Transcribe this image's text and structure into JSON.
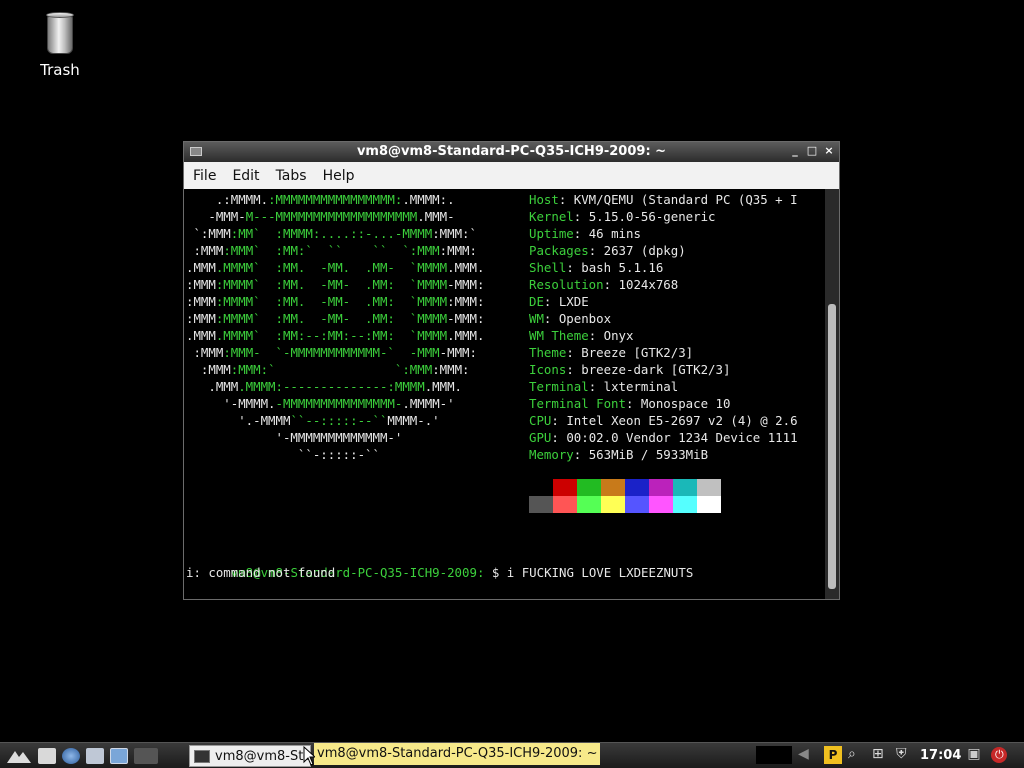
{
  "desktop": {
    "trash_label": "Trash"
  },
  "window": {
    "title": "vm8@vm8-Standard-PC-Q35-ICH9-2009: ~",
    "controls": [
      "_",
      "□",
      "×"
    ],
    "menu": [
      "File",
      "Edit",
      "Tabs",
      "Help"
    ]
  },
  "logo_lines": [
    [
      {
        "t": "    .:MMMM.",
        "c": "w"
      },
      {
        "t": ":MMMMMMMMMMMMMMMM:",
        "c": "g"
      },
      {
        "t": ".MMMM:.",
        "c": "w"
      }
    ],
    [
      {
        "t": "   -MMM-",
        "c": "w"
      },
      {
        "t": "M---MMMMMMMMMMMMMMMMMMM",
        "c": "g"
      },
      {
        "t": ".MMM-",
        "c": "w"
      }
    ],
    [
      {
        "t": " `:MMM",
        "c": "w"
      },
      {
        "t": ":MM`  :MMMM:....::-...-MMMM",
        "c": "g"
      },
      {
        "t": ":MMM:`",
        "c": "w"
      }
    ],
    [
      {
        "t": " :MMM",
        "c": "w"
      },
      {
        "t": ":MMM`  :MM:`  ``    ``  `:MMM",
        "c": "g"
      },
      {
        "t": ":MMM:",
        "c": "w"
      }
    ],
    [
      {
        "t": ".MMM",
        "c": "w"
      },
      {
        "t": ".MMMM`  :MM.  -MM.  .MM-  `MMMM",
        "c": "g"
      },
      {
        "t": ".MMM.",
        "c": "w"
      }
    ],
    [
      {
        "t": ":MMM",
        "c": "w"
      },
      {
        "t": ":MMMM`  :MM.  -MM-  .MM:  `MMMM",
        "c": "g"
      },
      {
        "t": "-MMM:",
        "c": "w"
      }
    ],
    [
      {
        "t": ":MMM",
        "c": "w"
      },
      {
        "t": ":MMMM`  :MM.  -MM-  .MM:  `MMMM",
        "c": "g"
      },
      {
        "t": ":MMM:",
        "c": "w"
      }
    ],
    [
      {
        "t": ":MMM",
        "c": "w"
      },
      {
        "t": ":MMMM`  :MM.  -MM-  .MM:  `MMMM",
        "c": "g"
      },
      {
        "t": "-MMM:",
        "c": "w"
      }
    ],
    [
      {
        "t": ".MMM",
        "c": "w"
      },
      {
        "t": ".MMMM`  :MM:--:MM:--:MM:  `MMMM",
        "c": "g"
      },
      {
        "t": ".MMM.",
        "c": "w"
      }
    ],
    [
      {
        "t": " :MMM",
        "c": "w"
      },
      {
        "t": ":MMM-  `-MMMMMMMMMMMM-`  -MMM",
        "c": "g"
      },
      {
        "t": "-MMM:",
        "c": "w"
      }
    ],
    [
      {
        "t": "  :MMM",
        "c": "w"
      },
      {
        "t": ":MMM:`                `:MMM",
        "c": "g"
      },
      {
        "t": ":MMM:",
        "c": "w"
      }
    ],
    [
      {
        "t": "   .MMM",
        "c": "w"
      },
      {
        "t": ".MMMM:--------------:MMMM",
        "c": "g"
      },
      {
        "t": ".MMM.",
        "c": "w"
      }
    ],
    [
      {
        "t": "     '-MMMM.",
        "c": "w"
      },
      {
        "t": "-MMMMMMMMMMMMMMM-",
        "c": "g"
      },
      {
        "t": ".MMMM-'",
        "c": "w"
      }
    ],
    [
      {
        "t": "       '.-MMMM",
        "c": "w"
      },
      {
        "t": "``--:::::--``",
        "c": "g"
      },
      {
        "t": "MMMM-.'",
        "c": "w"
      }
    ],
    [
      {
        "t": "            '-MMMMMMMMMMMMM-'",
        "c": "w"
      }
    ],
    [
      {
        "t": "               ``-:::::-``",
        "c": "w"
      }
    ]
  ],
  "info": [
    {
      "label": "Host",
      "value": "KVM/QEMU (Standard PC (Q35 + I"
    },
    {
      "label": "Kernel",
      "value": "5.15.0-56-generic"
    },
    {
      "label": "Uptime",
      "value": "46 mins"
    },
    {
      "label": "Packages",
      "value": "2637 (dpkg)"
    },
    {
      "label": "Shell",
      "value": "bash 5.1.16"
    },
    {
      "label": "Resolution",
      "value": "1024x768"
    },
    {
      "label": "DE",
      "value": "LXDE"
    },
    {
      "label": "WM",
      "value": "Openbox"
    },
    {
      "label": "WM Theme",
      "value": "Onyx"
    },
    {
      "label": "Theme",
      "value": "Breeze [GTK2/3]"
    },
    {
      "label": "Icons",
      "value": "breeze-dark [GTK2/3]"
    },
    {
      "label": "Terminal",
      "value": "lxterminal"
    },
    {
      "label": "Terminal Font",
      "value": "Monospace 10"
    },
    {
      "label": "CPU",
      "value": "Intel Xeon E5-2697 v2 (4) @ 2.6"
    },
    {
      "label": "GPU",
      "value": "00:02.0 Vendor 1234 Device 1111"
    },
    {
      "label": "Memory",
      "value": "563MiB / 5933MiB"
    }
  ],
  "palette": {
    "row1": [
      "#000000",
      "#cc0000",
      "#22bb22",
      "#c87a1a",
      "#1a22c8",
      "#bb22bb",
      "#1ab8b8",
      "#c0c0c0"
    ],
    "row2": [
      "#555555",
      "#ff5555",
      "#55ff55",
      "#ffff55",
      "#5555ff",
      "#ff55ff",
      "#55ffff",
      "#ffffff"
    ]
  },
  "session": {
    "prompt": "vm8@vm8-Standard-PC-Q35-ICH9-2009:",
    "command": " $ i FUCKING LOVE LXDEEZNUTS",
    "error": "i: command not found",
    "prompt_symbol": " $ "
  },
  "taskbar": {
    "task_label": "vm8@vm8-Standard-PC-Q35-ICH9-2009: ~",
    "tooltip": "vm8@vm8-Standard-PC-Q35-ICH9-2009: ~",
    "clock": "17:04"
  }
}
